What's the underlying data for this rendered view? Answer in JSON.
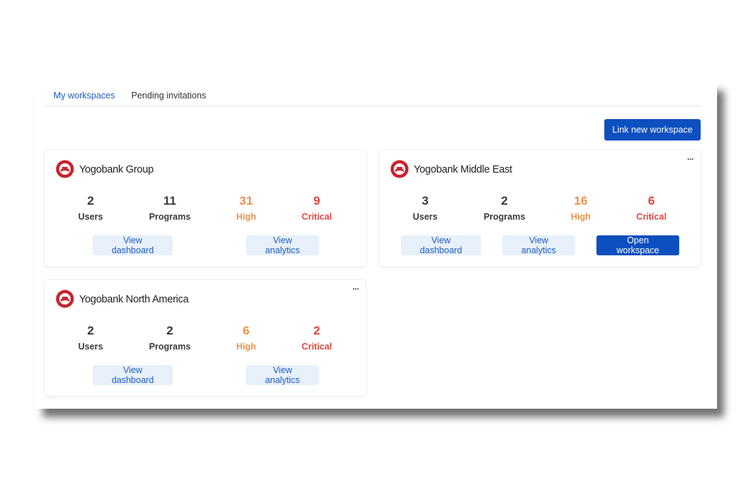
{
  "tabs": {
    "active": "My workspaces",
    "pending": "Pending invitations"
  },
  "actions": {
    "link_new": "Link new workspace"
  },
  "labels": {
    "users": "Users",
    "programs": "Programs",
    "high": "High",
    "critical": "Critical",
    "view_dashboard": "View dashboard",
    "view_analytics": "View analytics",
    "open_workspace": "Open workspace",
    "more": "···"
  },
  "workspaces": [
    {
      "name": "Yogobank Group",
      "users": "2",
      "programs": "11",
      "high": "31",
      "critical": "9"
    },
    {
      "name": "Yogobank Middle East",
      "users": "3",
      "programs": "2",
      "high": "16",
      "critical": "6"
    },
    {
      "name": "Yogobank North America",
      "users": "2",
      "programs": "2",
      "high": "6",
      "critical": "2"
    }
  ],
  "colors": {
    "accent": "#0d4fbf",
    "link": "#1f5cc2",
    "high": "#f0914b",
    "critical": "#e0463f",
    "logo": "#c8242f"
  },
  "icons": {
    "logo": "yogobank-logo-icon",
    "more": "more-options-icon"
  }
}
